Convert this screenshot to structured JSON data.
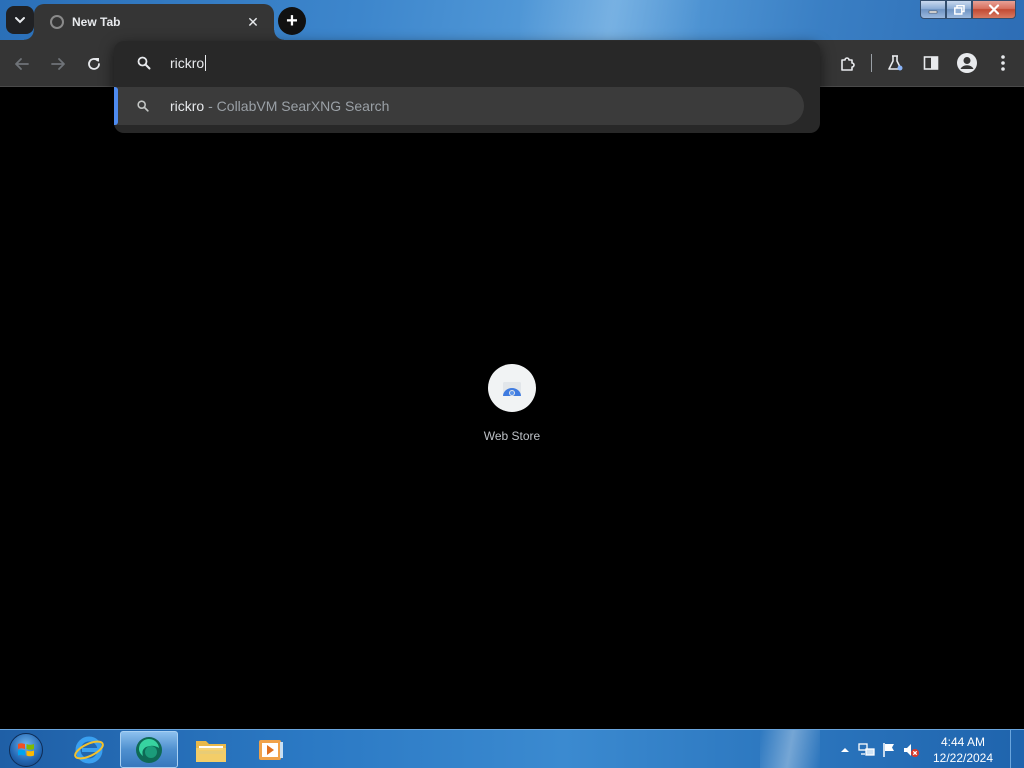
{
  "browser": {
    "tab": {
      "title": "New Tab",
      "close_glyph": "✕",
      "favicon": "globe-icon"
    },
    "new_tab_glyph": "+",
    "window_controls": {
      "minimize": "minimize-icon",
      "maximize": "restore-icon",
      "close": "close-icon"
    },
    "toolbar": {
      "back": "arrow-back-icon",
      "forward": "arrow-forward-icon",
      "reload": "reload-icon",
      "right_icons": [
        "extensions-icon",
        "labs-icon",
        "side-panel-icon",
        "profile-icon",
        "more-vert-icon"
      ]
    },
    "omnibox": {
      "value": "rickro",
      "suggestions": [
        {
          "query": "rickro",
          "description": " - CollabVM SearXNG Search",
          "icon": "search-icon"
        }
      ]
    }
  },
  "page": {
    "shortcuts": [
      {
        "label": "Web Store",
        "icon": "web-store-icon"
      }
    ]
  },
  "taskbar": {
    "pinned": [
      "internet-explorer-icon",
      "browser-icon",
      "file-explorer-icon",
      "media-player-icon"
    ],
    "clock": {
      "time": "4:44 AM",
      "date": "12/22/2024"
    },
    "tray_icons": [
      "show-hidden-icons-icon",
      "network-icon",
      "action-center-flag-icon",
      "volume-muted-icon"
    ]
  },
  "colors": {
    "accent": "#4d8af0",
    "toolbar_bg": "#353535",
    "popup_bg": "#282828",
    "suggestion_bg": "#3b3b3b",
    "page_bg": "#000000"
  }
}
